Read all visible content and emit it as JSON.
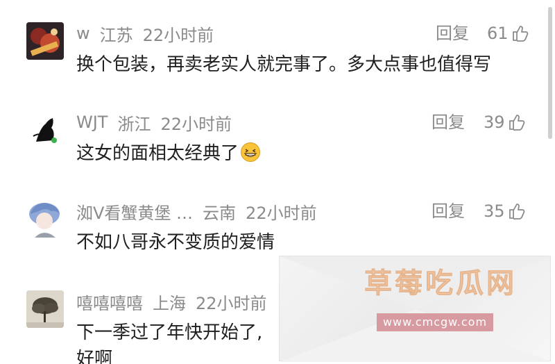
{
  "comments": [
    {
      "username": "w",
      "location": "江苏",
      "time": "22小时前",
      "reply_label": "回复",
      "likes": "61",
      "text": "换个包装，再卖老实人就完事了。多大点事也值得写",
      "avatar": "avatar-dark-artwork"
    },
    {
      "username": "WJT",
      "location": "浙江",
      "time": "22小时前",
      "reply_label": "回复",
      "likes": "39",
      "text": "这女的面相太经典了",
      "emoji": "grinning-face-emoji",
      "avatar": "avatar-black-cat"
    },
    {
      "username": "洳V看蟹黄堡 …",
      "location": "云南",
      "time": "22小时前",
      "reply_label": "回复",
      "likes": "35",
      "text": "不如八哥永不变质的爱情",
      "avatar": "avatar-blue-hair-anime"
    },
    {
      "username": "嘻嘻嘻嘻",
      "location": "上海",
      "time": "22小时前",
      "text_line1": "下一季过了年快开始了,",
      "text_line2": "好啊",
      "avatar": "avatar-tree"
    }
  ],
  "watermark": {
    "title": "草莓吃瓜网",
    "url": "www.cmcgw.com"
  },
  "colors": {
    "meta_gray": "#8a8a8a",
    "text": "#1f1f1f",
    "watermark_title": "#f1c9a8",
    "watermark_url_bg": "#d79aa0"
  }
}
